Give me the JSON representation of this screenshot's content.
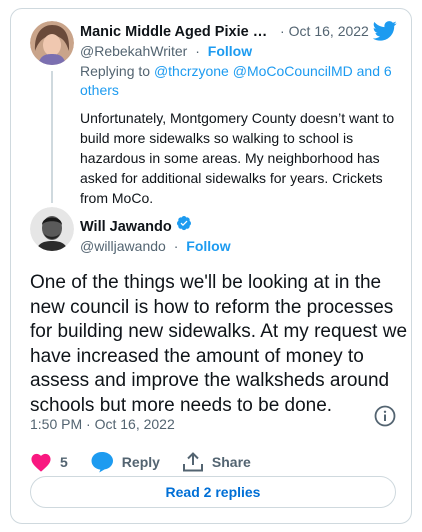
{
  "parent_tweet": {
    "display_name": "Manic Middle Aged Pixie Dr...",
    "date": "Oct 16, 2022",
    "handle": "@RebekahWriter",
    "follow_label": "Follow",
    "replying_prefix": "Replying to",
    "mentions_line": "@thcrzyone @MoCoCouncilMD and 6",
    "others_label": "others",
    "text": "Unfortunately, Montgomery County doesn’t want to build more sidewalks so walking to school is hazardous in some areas. My neighborhood has asked for additional sidewalks for years. Crickets from MoCo."
  },
  "reply_tweet": {
    "display_name": "Will Jawando",
    "handle": "@willjawando",
    "follow_label": "Follow",
    "text": "One of the things we'll be looking at in the new council is how to reform the processes for building new sidewalks.  At my request we have increased the amount of money to assess and improve the walksheds around schools but more needs to be done.",
    "timestamp": "1:50 PM · Oct 16, 2022"
  },
  "actions": {
    "like_count": "5",
    "reply_label": "Reply",
    "share_label": "Share"
  },
  "read_replies_label": "Read 2 replies",
  "icons": [
    "twitter-logo-icon",
    "verified-badge-icon",
    "info-icon",
    "heart-icon",
    "reply-bubble-icon",
    "share-icon"
  ],
  "colors": {
    "brand_blue": "#1d9bf0",
    "like_pink": "#f91880",
    "text_secondary": "#536471",
    "border": "#cfd9de"
  }
}
